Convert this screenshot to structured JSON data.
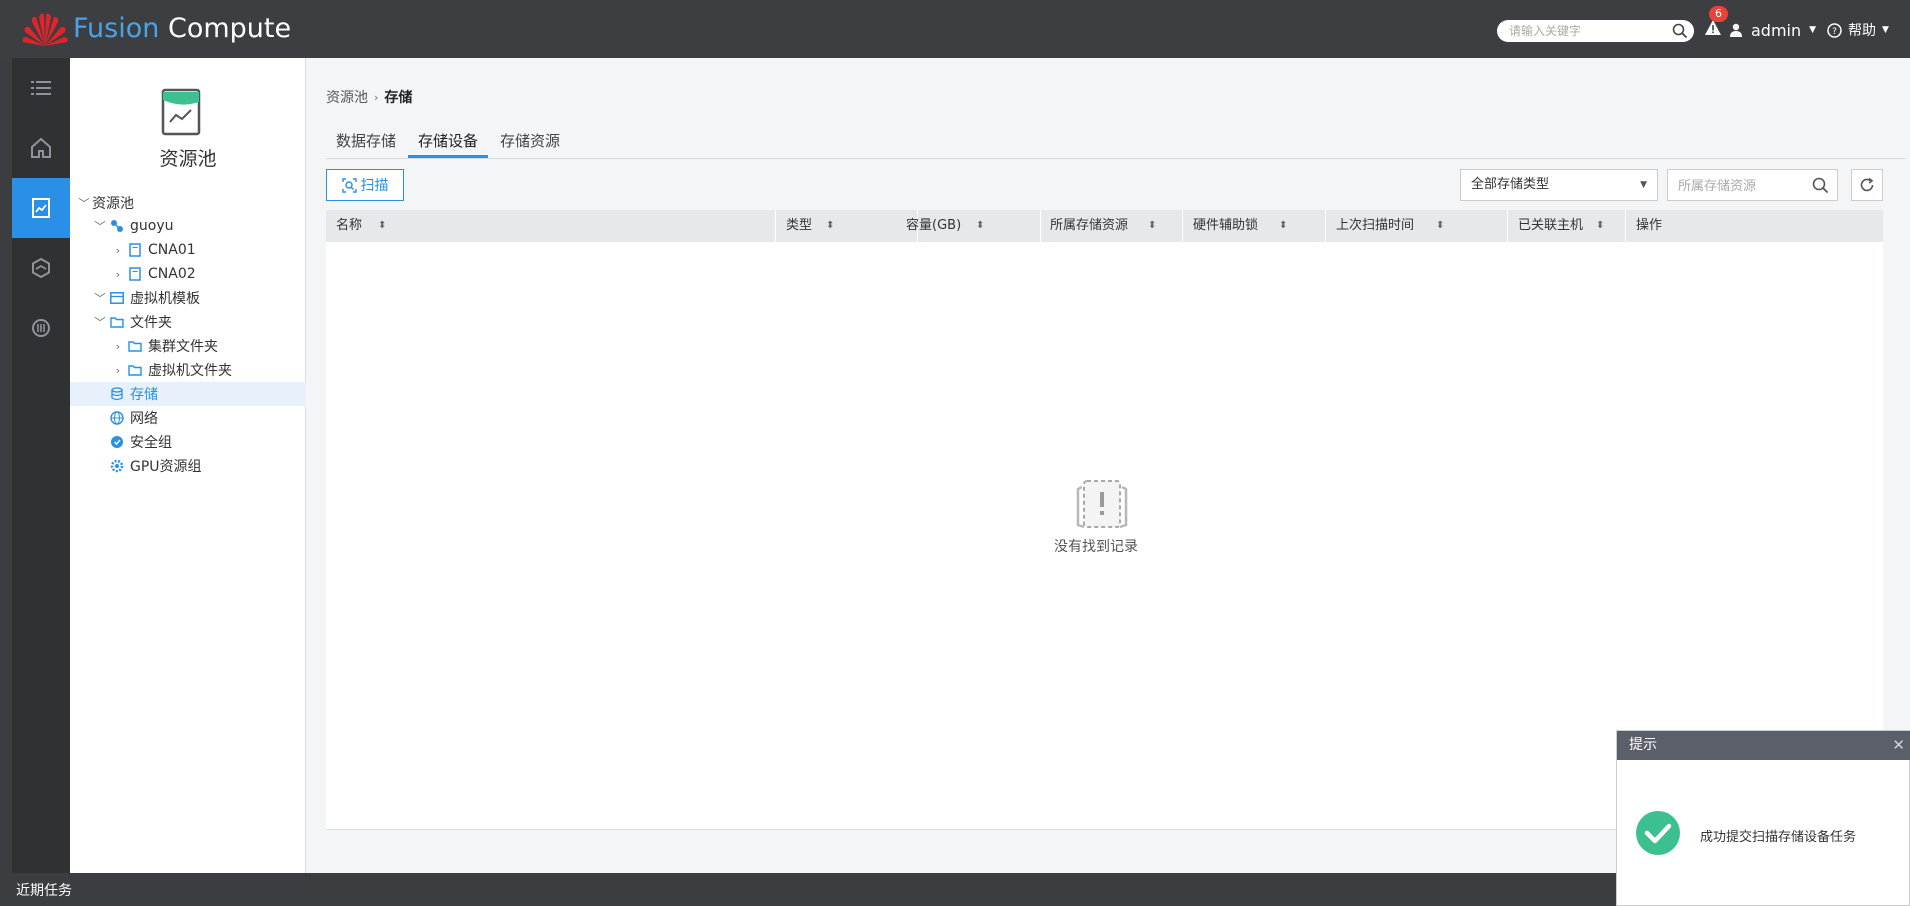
{
  "header": {
    "brand_part1": "Fusion",
    "brand_part2": "Compute",
    "search_placeholder": "请输入关键字",
    "alarm_count": "6",
    "user": "admin",
    "help": "帮助"
  },
  "rail": {
    "items": [
      "list-icon",
      "home-icon",
      "resource-pool-icon",
      "network-icon",
      "monitor-icon"
    ],
    "active_index": 2
  },
  "tree": {
    "title": "资源池",
    "nodes": [
      {
        "label": "资源池"
      },
      {
        "label": "guoyu"
      },
      {
        "label": "CNA01"
      },
      {
        "label": "CNA02"
      },
      {
        "label": "虚拟机模板"
      },
      {
        "label": "文件夹"
      },
      {
        "label": "集群文件夹"
      },
      {
        "label": "虚拟机文件夹"
      },
      {
        "label": "存储"
      },
      {
        "label": "网络"
      },
      {
        "label": "安全组"
      },
      {
        "label": "GPU资源组"
      }
    ]
  },
  "main": {
    "breadcrumb": [
      "资源池",
      "存储"
    ],
    "tabs": [
      "数据存储",
      "存储设备",
      "存储资源"
    ],
    "active_tab": 1,
    "scan_label": "扫描",
    "type_filter": "全部存储类型",
    "resource_placeholder": "所属存储资源",
    "columns": [
      "名称",
      "类型",
      "容量(GB)",
      "所属存储资源",
      "硬件辅助锁",
      "上次扫描时间",
      "已关联主机",
      "操作"
    ],
    "empty_text": "没有找到记录"
  },
  "footer": {
    "recent_tasks": "近期任务"
  },
  "toast": {
    "title": "提示",
    "message": "成功提交扫描存储设备任务"
  },
  "colors": {
    "accent": "#2a8fe6",
    "topbar": "#3c3e41",
    "success": "#3cc08f",
    "alarm": "#e9423a"
  }
}
